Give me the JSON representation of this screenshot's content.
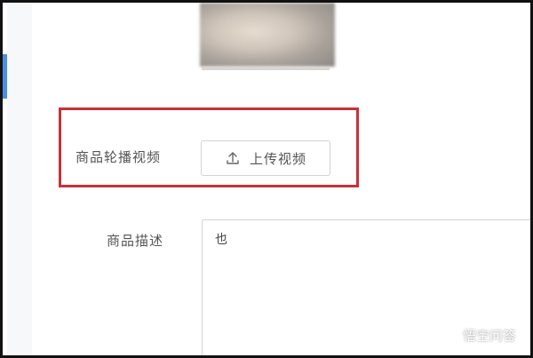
{
  "form": {
    "video_label": "商品轮播视频",
    "upload_button_label": "上传视频",
    "description_label": "商品描述",
    "description_value": "也"
  },
  "watermark": {
    "text": "悟空问答",
    "icon": "wukong-logo-icon"
  },
  "colors": {
    "highlight": "#c8303a",
    "accent": "#4a8fe0",
    "border": "#cfd3d8"
  },
  "icons": {
    "upload": "upload-arrow-icon"
  }
}
